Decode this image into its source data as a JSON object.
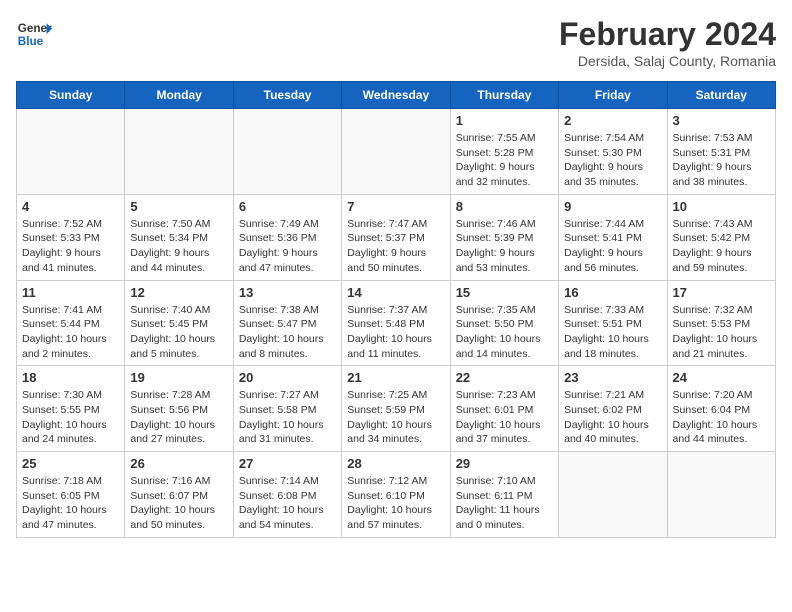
{
  "header": {
    "logo_line1": "General",
    "logo_line2": "Blue",
    "month_title": "February 2024",
    "location": "Dersida, Salaj County, Romania"
  },
  "days_of_week": [
    "Sunday",
    "Monday",
    "Tuesday",
    "Wednesday",
    "Thursday",
    "Friday",
    "Saturday"
  ],
  "weeks": [
    [
      {
        "day": "",
        "info": ""
      },
      {
        "day": "",
        "info": ""
      },
      {
        "day": "",
        "info": ""
      },
      {
        "day": "",
        "info": ""
      },
      {
        "day": "1",
        "info": "Sunrise: 7:55 AM\nSunset: 5:28 PM\nDaylight: 9 hours\nand 32 minutes."
      },
      {
        "day": "2",
        "info": "Sunrise: 7:54 AM\nSunset: 5:30 PM\nDaylight: 9 hours\nand 35 minutes."
      },
      {
        "day": "3",
        "info": "Sunrise: 7:53 AM\nSunset: 5:31 PM\nDaylight: 9 hours\nand 38 minutes."
      }
    ],
    [
      {
        "day": "4",
        "info": "Sunrise: 7:52 AM\nSunset: 5:33 PM\nDaylight: 9 hours\nand 41 minutes."
      },
      {
        "day": "5",
        "info": "Sunrise: 7:50 AM\nSunset: 5:34 PM\nDaylight: 9 hours\nand 44 minutes."
      },
      {
        "day": "6",
        "info": "Sunrise: 7:49 AM\nSunset: 5:36 PM\nDaylight: 9 hours\nand 47 minutes."
      },
      {
        "day": "7",
        "info": "Sunrise: 7:47 AM\nSunset: 5:37 PM\nDaylight: 9 hours\nand 50 minutes."
      },
      {
        "day": "8",
        "info": "Sunrise: 7:46 AM\nSunset: 5:39 PM\nDaylight: 9 hours\nand 53 minutes."
      },
      {
        "day": "9",
        "info": "Sunrise: 7:44 AM\nSunset: 5:41 PM\nDaylight: 9 hours\nand 56 minutes."
      },
      {
        "day": "10",
        "info": "Sunrise: 7:43 AM\nSunset: 5:42 PM\nDaylight: 9 hours\nand 59 minutes."
      }
    ],
    [
      {
        "day": "11",
        "info": "Sunrise: 7:41 AM\nSunset: 5:44 PM\nDaylight: 10 hours\nand 2 minutes."
      },
      {
        "day": "12",
        "info": "Sunrise: 7:40 AM\nSunset: 5:45 PM\nDaylight: 10 hours\nand 5 minutes."
      },
      {
        "day": "13",
        "info": "Sunrise: 7:38 AM\nSunset: 5:47 PM\nDaylight: 10 hours\nand 8 minutes."
      },
      {
        "day": "14",
        "info": "Sunrise: 7:37 AM\nSunset: 5:48 PM\nDaylight: 10 hours\nand 11 minutes."
      },
      {
        "day": "15",
        "info": "Sunrise: 7:35 AM\nSunset: 5:50 PM\nDaylight: 10 hours\nand 14 minutes."
      },
      {
        "day": "16",
        "info": "Sunrise: 7:33 AM\nSunset: 5:51 PM\nDaylight: 10 hours\nand 18 minutes."
      },
      {
        "day": "17",
        "info": "Sunrise: 7:32 AM\nSunset: 5:53 PM\nDaylight: 10 hours\nand 21 minutes."
      }
    ],
    [
      {
        "day": "18",
        "info": "Sunrise: 7:30 AM\nSunset: 5:55 PM\nDaylight: 10 hours\nand 24 minutes."
      },
      {
        "day": "19",
        "info": "Sunrise: 7:28 AM\nSunset: 5:56 PM\nDaylight: 10 hours\nand 27 minutes."
      },
      {
        "day": "20",
        "info": "Sunrise: 7:27 AM\nSunset: 5:58 PM\nDaylight: 10 hours\nand 31 minutes."
      },
      {
        "day": "21",
        "info": "Sunrise: 7:25 AM\nSunset: 5:59 PM\nDaylight: 10 hours\nand 34 minutes."
      },
      {
        "day": "22",
        "info": "Sunrise: 7:23 AM\nSunset: 6:01 PM\nDaylight: 10 hours\nand 37 minutes."
      },
      {
        "day": "23",
        "info": "Sunrise: 7:21 AM\nSunset: 6:02 PM\nDaylight: 10 hours\nand 40 minutes."
      },
      {
        "day": "24",
        "info": "Sunrise: 7:20 AM\nSunset: 6:04 PM\nDaylight: 10 hours\nand 44 minutes."
      }
    ],
    [
      {
        "day": "25",
        "info": "Sunrise: 7:18 AM\nSunset: 6:05 PM\nDaylight: 10 hours\nand 47 minutes."
      },
      {
        "day": "26",
        "info": "Sunrise: 7:16 AM\nSunset: 6:07 PM\nDaylight: 10 hours\nand 50 minutes."
      },
      {
        "day": "27",
        "info": "Sunrise: 7:14 AM\nSunset: 6:08 PM\nDaylight: 10 hours\nand 54 minutes."
      },
      {
        "day": "28",
        "info": "Sunrise: 7:12 AM\nSunset: 6:10 PM\nDaylight: 10 hours\nand 57 minutes."
      },
      {
        "day": "29",
        "info": "Sunrise: 7:10 AM\nSunset: 6:11 PM\nDaylight: 11 hours\nand 0 minutes."
      },
      {
        "day": "",
        "info": ""
      },
      {
        "day": "",
        "info": ""
      }
    ]
  ]
}
